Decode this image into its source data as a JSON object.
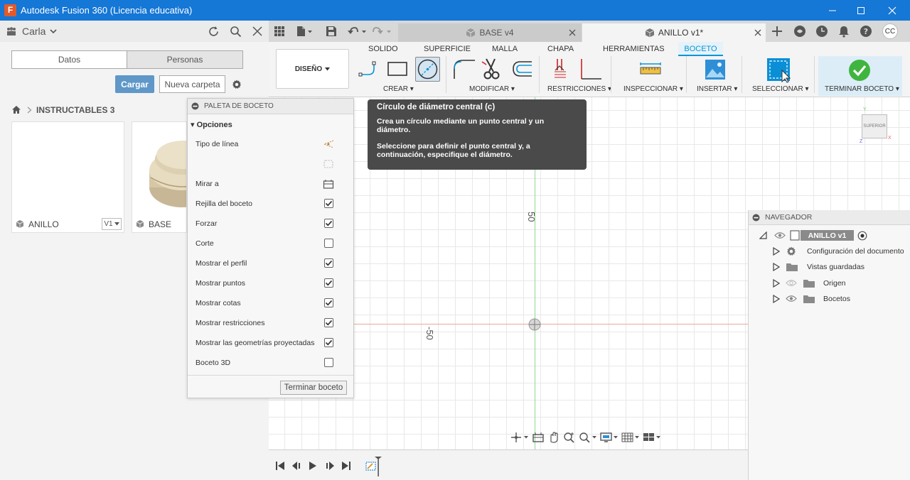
{
  "window": {
    "title": "Autodesk Fusion 360 (Licencia educativa)",
    "logo_letter": "F"
  },
  "data_panel": {
    "user": "Carla",
    "tabs": [
      "Datos",
      "Personas"
    ],
    "upload_label": "Cargar",
    "new_folder_label": "Nueva carpeta",
    "breadcrumb": "INSTRUCTABLES 3",
    "files": [
      {
        "name": "ANILLO",
        "version": "V1"
      },
      {
        "name": "BASE"
      }
    ]
  },
  "doc_tabs": [
    {
      "label": "BASE v4",
      "active": false
    },
    {
      "label": "ANILLO v1*",
      "active": true
    }
  ],
  "header_icons": {
    "user_initials": "CC"
  },
  "ribbon": {
    "workspace": "DISEÑO",
    "tabs": [
      "SOLIDO",
      "SUPERFICIE",
      "MALLA",
      "CHAPA",
      "HERRAMIENTAS",
      "BOCETO"
    ],
    "active_tab": "BOCETO",
    "groups": [
      "CREAR",
      "MODIFICAR",
      "RESTRICCIONES",
      "INSPECCIONAR",
      "INSERTAR",
      "SELECCIONAR",
      "TERMINAR BOCETO"
    ],
    "accent": "#0696d7",
    "finish_color": "#3fb53f"
  },
  "palette": {
    "title": "PALETA DE BOCETO",
    "section": "Opciones",
    "rows": [
      {
        "label": "Tipo de línea",
        "type": "icon"
      },
      {
        "label": "",
        "type": "icon"
      },
      {
        "label": "Mirar a",
        "type": "icon"
      },
      {
        "label": "Rejilla del boceto",
        "type": "checkbox",
        "checked": true
      },
      {
        "label": "Forzar",
        "type": "checkbox",
        "checked": true
      },
      {
        "label": "Corte",
        "type": "checkbox",
        "checked": false
      },
      {
        "label": "Mostrar el perfil",
        "type": "checkbox",
        "checked": true
      },
      {
        "label": "Mostrar puntos",
        "type": "checkbox",
        "checked": true
      },
      {
        "label": "Mostrar cotas",
        "type": "checkbox",
        "checked": true
      },
      {
        "label": "Mostrar restricciones",
        "type": "checkbox",
        "checked": true
      },
      {
        "label": "Mostrar las geometrías proyectadas",
        "type": "checkbox",
        "checked": true
      },
      {
        "label": "Boceto 3D",
        "type": "checkbox",
        "checked": false
      }
    ],
    "finish_label": "Terminar boceto"
  },
  "tooltip": {
    "title": "Círculo de diámetro central (c)",
    "line1": "Crea un círculo mediante un punto central y un diámetro.",
    "line2": "Seleccione para definir el punto central y, a continuación, especifique el diámetro."
  },
  "canvas": {
    "label_top": "50",
    "label_left": "-50",
    "viewcube": "SUPERIOR"
  },
  "navigator": {
    "title": "NAVEGADOR",
    "root": "ANILLO v1",
    "items": [
      "Configuración del documento",
      "Vistas guardadas",
      "Origen",
      "Bocetos"
    ]
  }
}
